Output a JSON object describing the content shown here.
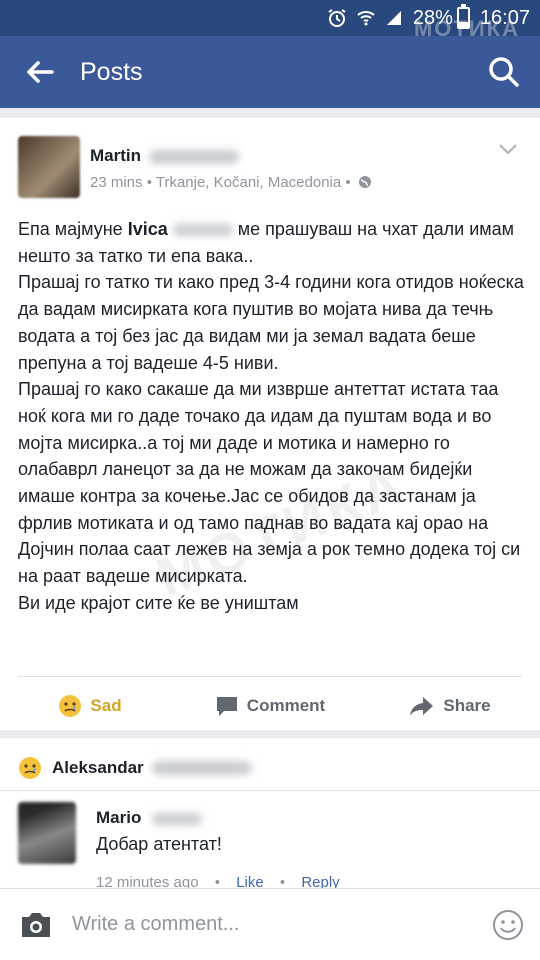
{
  "status_bar": {
    "battery": "28%",
    "time": "16:07",
    "watermark": "МОТИКА"
  },
  "app_bar": {
    "title": "Posts",
    "back_icon": "back-arrow-icon",
    "search_icon": "search-icon"
  },
  "post": {
    "author_first": "Martin",
    "meta": "23 mins • Trkanje, Kočani, Macedonia •",
    "text_pre": "Епа мајмуне ",
    "mention": "Ivica",
    "text_post": " ме прашуваш на чхат дали имам нешто за татко ти епа вака..",
    "paragraph2": "Прашај го татко ти како пред 3-4 години кога отидов ноќеска да вадам мисирката кога пуштив во мојата нива да течњ водата а тој без јас да видам ми ја земал вадата беше препуна а тој вадеше 4-5 ниви.",
    "paragraph3": "Прашај го како сакаше да ми изврше антеттат истата таа ноќ кога ми го даде точако да идам да пуштам вода и во мојта мисирка..а тој ми даде и мотика и намерно го олабаврл ланецот за да не можам да закочам бидејќи имаше контра за кочење.Јас се обидов да застанам ја фрлив мотиката и од тамо паднав во вадата кај орао на Дојчин полаа саат лежев на земја а рок темно додека тој си на раат вадеше мисирката.",
    "paragraph4": "Ви иде крајот сите ќе ве уништам",
    "watermark": "МОТИКА",
    "actions": {
      "sad": "Sad",
      "comment": "Comment",
      "share": "Share"
    }
  },
  "reactions": {
    "name": "Aleksandar"
  },
  "comment": {
    "author": "Mario",
    "text": "Добар атентат!",
    "time": "12 minutes ago",
    "like": "Like",
    "reply": "Reply"
  },
  "composer": {
    "placeholder": "Write a comment..."
  },
  "colors": {
    "header": "#3b5998",
    "status": "#29487d",
    "link": "#4267b2",
    "sad": "#d4a52a"
  }
}
